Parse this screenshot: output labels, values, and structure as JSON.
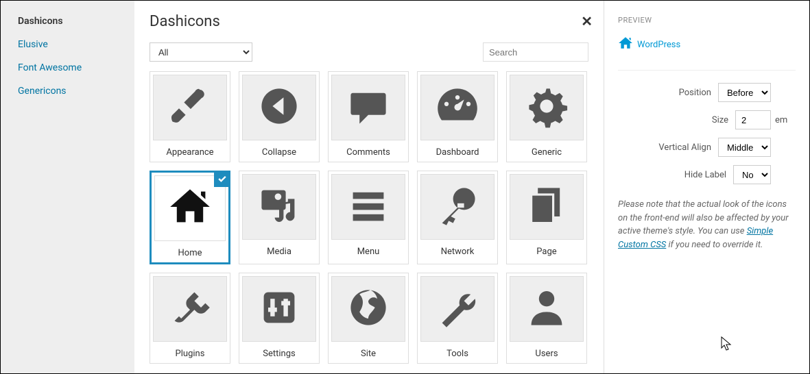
{
  "sidebar": {
    "items": [
      {
        "label": "Dashicons",
        "active": true
      },
      {
        "label": "Elusive",
        "active": false
      },
      {
        "label": "Font Awesome",
        "active": false
      },
      {
        "label": "Genericons",
        "active": false
      }
    ]
  },
  "main": {
    "title": "Dashicons",
    "filter_value": "All",
    "search_placeholder": "Search"
  },
  "icons": [
    {
      "name": "appearance-icon",
      "label": "Appearance",
      "selected": false
    },
    {
      "name": "collapse-icon",
      "label": "Collapse",
      "selected": false
    },
    {
      "name": "comments-icon",
      "label": "Comments",
      "selected": false
    },
    {
      "name": "dashboard-icon",
      "label": "Dashboard",
      "selected": false
    },
    {
      "name": "generic-icon",
      "label": "Generic",
      "selected": false
    },
    {
      "name": "home-icon",
      "label": "Home",
      "selected": true
    },
    {
      "name": "media-icon",
      "label": "Media",
      "selected": false
    },
    {
      "name": "menu-icon",
      "label": "Menu",
      "selected": false
    },
    {
      "name": "network-icon",
      "label": "Network",
      "selected": false
    },
    {
      "name": "page-icon",
      "label": "Page",
      "selected": false
    },
    {
      "name": "plugins-icon",
      "label": "Plugins",
      "selected": false
    },
    {
      "name": "settings-icon",
      "label": "Settings",
      "selected": false
    },
    {
      "name": "site-icon",
      "label": "Site",
      "selected": false
    },
    {
      "name": "tools-icon",
      "label": "Tools",
      "selected": false
    },
    {
      "name": "users-icon",
      "label": "Users",
      "selected": false
    }
  ],
  "preview": {
    "title": "PREVIEW",
    "label": "WordPress",
    "settings": {
      "position": {
        "label": "Position",
        "value": "Before"
      },
      "size": {
        "label": "Size",
        "value": "2",
        "unit": "em"
      },
      "valign": {
        "label": "Vertical Align",
        "value": "Middle"
      },
      "hide": {
        "label": "Hide Label",
        "value": "No"
      }
    },
    "note_prefix": "Please note that the actual look of the icons on the front-end will also be affected by your active theme's style. You can use ",
    "note_link": "Simple Custom CSS",
    "note_suffix": " if you need to override it."
  }
}
